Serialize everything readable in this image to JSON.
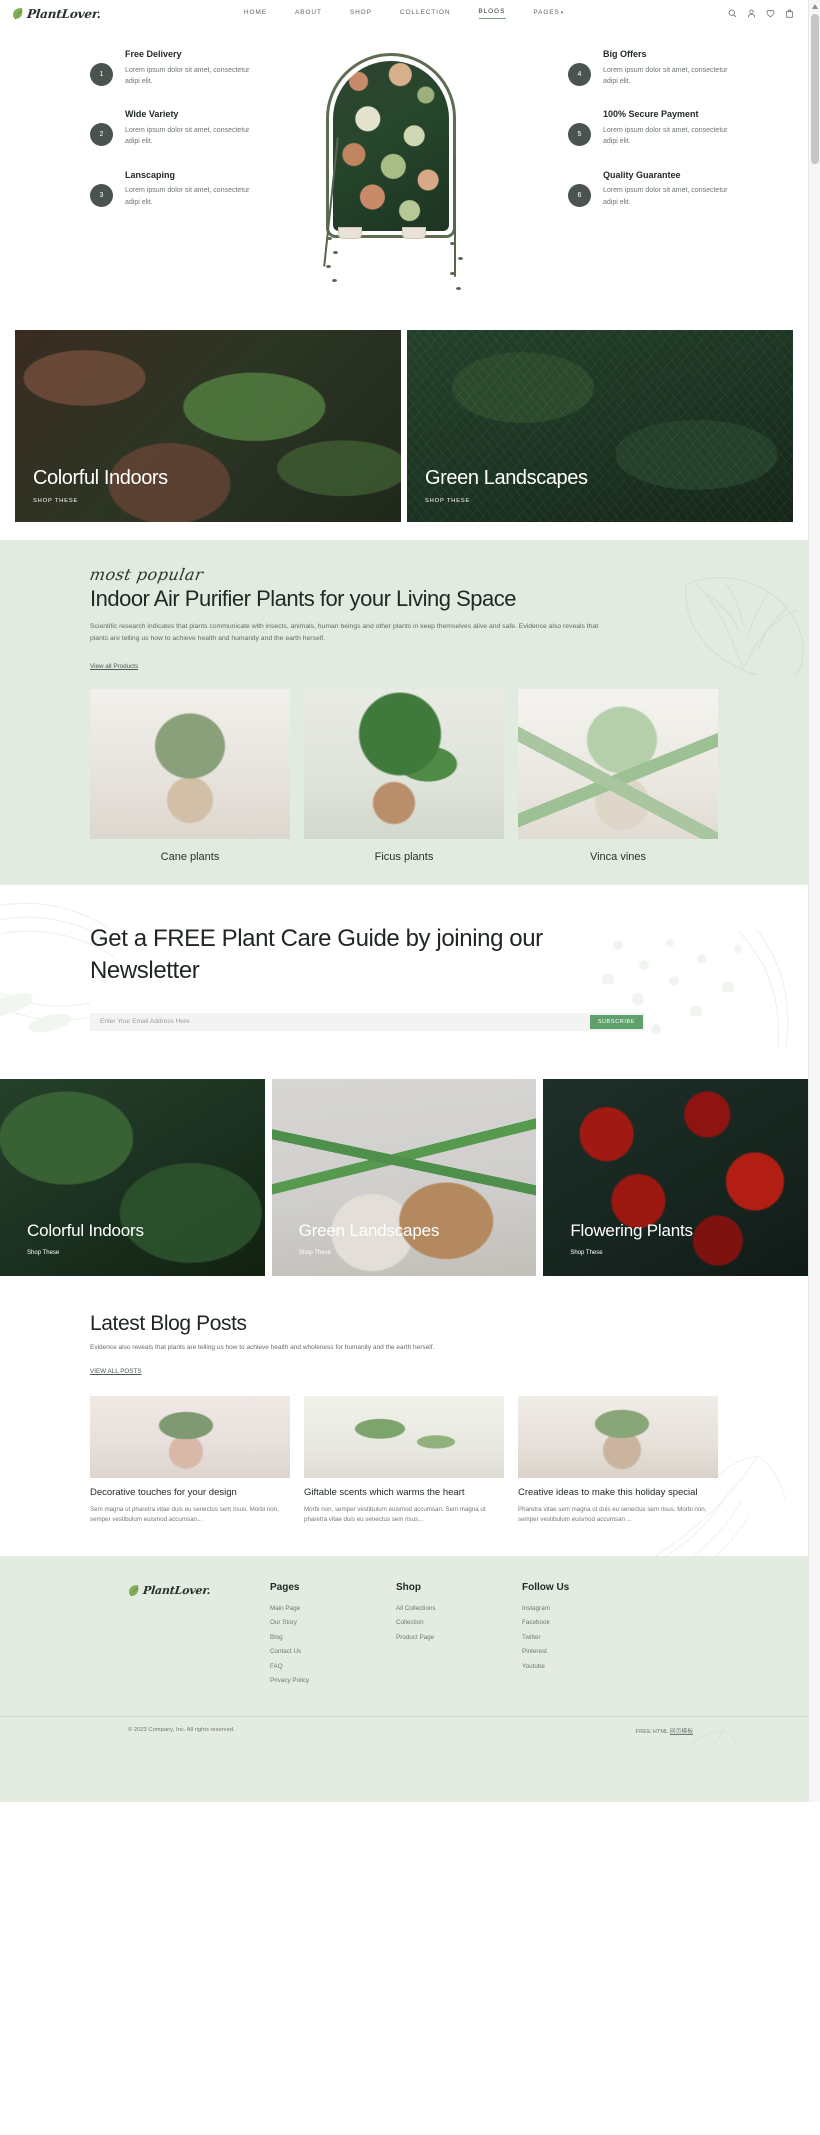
{
  "header": {
    "brand": "PlantLover.",
    "nav": [
      {
        "label": "HOME",
        "active": false
      },
      {
        "label": "ABOUT",
        "active": false
      },
      {
        "label": "SHOP",
        "active": false
      },
      {
        "label": "COLLECTION",
        "active": false
      },
      {
        "label": "BLOGS",
        "active": true
      },
      {
        "label": "PAGES",
        "active": false,
        "caret": "▾"
      }
    ],
    "icons": [
      "search-icon",
      "account-icon",
      "wishlist-heart-icon",
      "cart-bag-icon"
    ]
  },
  "features": {
    "left": [
      {
        "num": "1",
        "title": "Free Delivery",
        "desc": "Lorem ipsum dolor sit amet, consectetur adipi elit."
      },
      {
        "num": "2",
        "title": "Wide Variety",
        "desc": "Lorem ipsum dolor sit amet, consectetur adipi elit."
      },
      {
        "num": "3",
        "title": "Lanscaping",
        "desc": "Lorem ipsum dolor sit amet, consectetur adipi elit."
      }
    ],
    "right": [
      {
        "num": "4",
        "title": "Big Offers",
        "desc": "Lorem ipsum dolor sit amet, consectetur adipi elit."
      },
      {
        "num": "5",
        "title": "100% Secure Payment",
        "desc": "Lorem ipsum dolor sit amet, consectetur adipi elit."
      },
      {
        "num": "6",
        "title": "Quality Guarantee",
        "desc": "Lorem ipsum dolor sit amet, consectetur adipi elit."
      }
    ]
  },
  "banners": [
    {
      "title": "Colorful Indoors",
      "cta": "SHOP THESE"
    },
    {
      "title": "Green Landscapes",
      "cta": "SHOP THESE"
    }
  ],
  "popular": {
    "script_label": "most popular",
    "heading": "Indoor Air Purifier Plants for your Living Space",
    "lede": "Scientific research indicates that plants communicate with insects, animals, human beings and other plants in keep themselves alive and safe. Evidence also reveals that plants are telling us how to achieve health and humanity and the earth herself.",
    "link": "View all Products",
    "products": [
      {
        "name": "Cane plants"
      },
      {
        "name": "Ficus plants"
      },
      {
        "name": "Vinca vines"
      }
    ]
  },
  "newsletter": {
    "heading": "Get a FREE Plant Care Guide by joining our Newsletter",
    "placeholder": "Enter Your Email Address Here",
    "value": "",
    "button": "SUBSCRIBE",
    "accent": "#5fa06d"
  },
  "categories": [
    {
      "title": "Colorful Indoors",
      "cta": "Shop These"
    },
    {
      "title": "Green Landscapes",
      "cta": "Shop These"
    },
    {
      "title": "Flowering Plants",
      "cta": "Shop These"
    }
  ],
  "blog": {
    "heading": "Latest Blog Posts",
    "lede": "Evidence also reveals that plants are telling us how to achieve health and wholeness for humanity and the earth herself.",
    "link": "VIEW ALL POSTS",
    "posts": [
      {
        "title": "Decorative touches for your design",
        "excerpt": "Sem magna ut pharetra vitae duis eu senectus sem risus. Morbi non, semper vestibulum euismod accumsan..."
      },
      {
        "title": "Giftable scents which warms the heart",
        "excerpt": "Morbi non, semper vestibulum euismod accumsan. Sem magna ut pharetra vitae duis eu senectus sem risus..."
      },
      {
        "title": "Creative ideas to make this holiday special",
        "excerpt": "Pharetra vitae sem magna ut duis eu senectus sem risus. Morbi non, semper vestibulum euismod accumsan ..."
      }
    ]
  },
  "footer": {
    "brand": "PlantLover.",
    "columns": [
      {
        "heading": "Pages",
        "links": [
          "Main Page",
          "Our Story",
          "Blog",
          "Contact Us",
          "FAQ",
          "Privacy Policy"
        ]
      },
      {
        "heading": "Shop",
        "links": [
          "All Collections",
          "Collection",
          "Product Page"
        ]
      },
      {
        "heading": "Follow Us",
        "links": [
          "Instagram",
          "Facebook",
          "Twitter",
          "Pinterest",
          "Youtube"
        ]
      }
    ],
    "copyright": "© 2023 Company, Inc. All rights reserved.",
    "credit_prefix": "FREE HTML",
    "credit_link": "网页模板"
  }
}
